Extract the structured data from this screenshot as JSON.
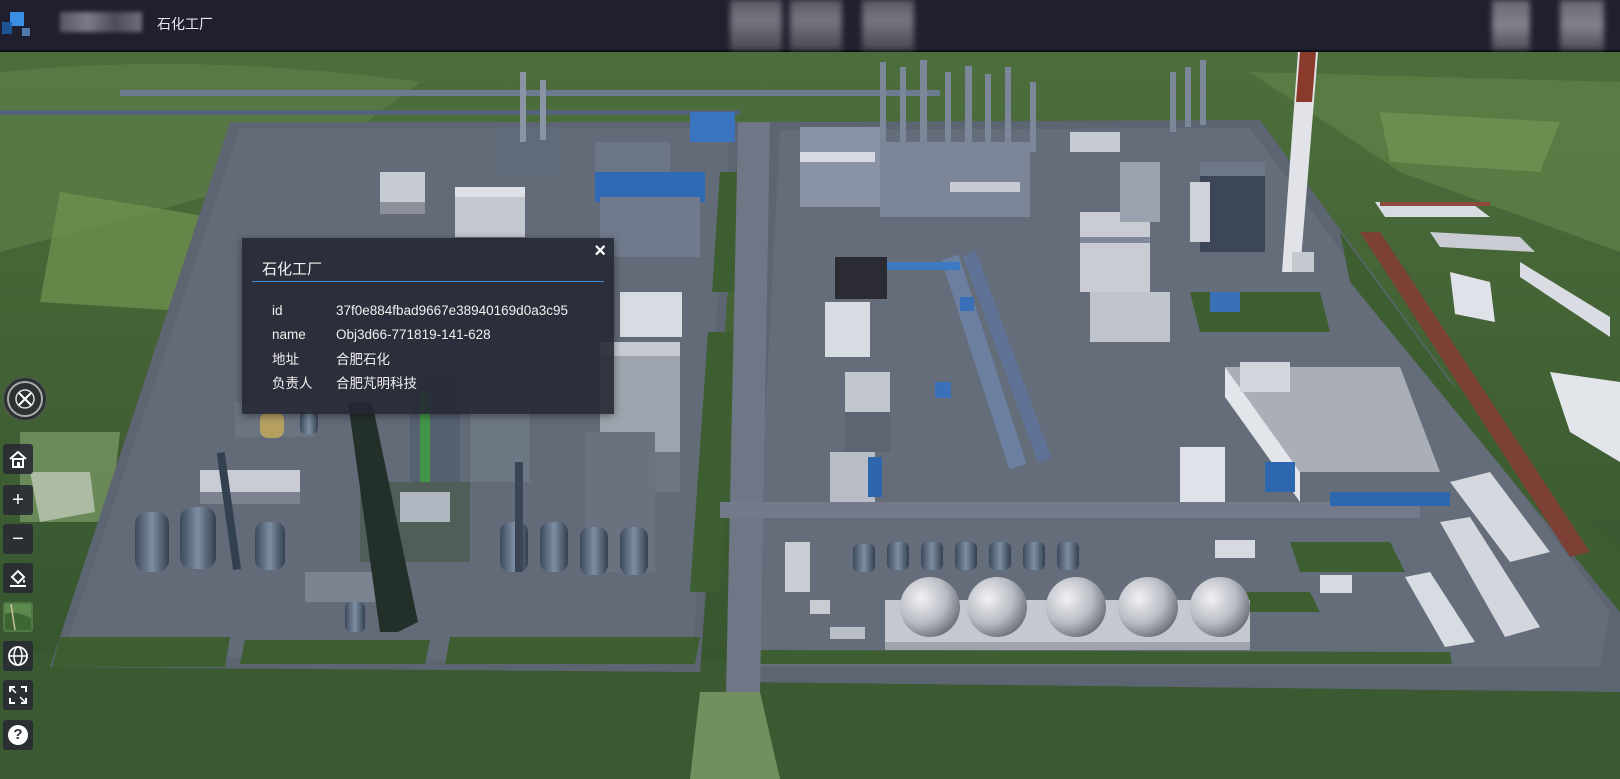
{
  "header": {
    "app_title": "石化工厂"
  },
  "popup": {
    "title": "石化工厂",
    "close_label": "×",
    "fields": [
      {
        "key": "id",
        "value": "37f0e884fbad9667e38940169d0a3c95"
      },
      {
        "key": "name",
        "value": "Obj3d66-771819-141-628"
      },
      {
        "key": "地址",
        "value": "合肥石化"
      },
      {
        "key": "负责人",
        "value": "合肥芃明科技"
      }
    ]
  },
  "toolbar": {
    "zoom_in_label": "+",
    "zoom_out_label": "−",
    "help_label": "?"
  },
  "colors": {
    "topbar_bg": "#1f1f2e",
    "accent": "#3e8bd8",
    "popup_bg": "#262834",
    "ground_green": "#3f6433",
    "plant_ground": "#5d6472"
  },
  "icons": [
    "compass-icon",
    "home-icon",
    "zoom-in-icon",
    "zoom-out-icon",
    "fill-style-icon",
    "basemap-icon",
    "globe-icon",
    "fullscreen-icon",
    "help-icon",
    "close-icon"
  ]
}
